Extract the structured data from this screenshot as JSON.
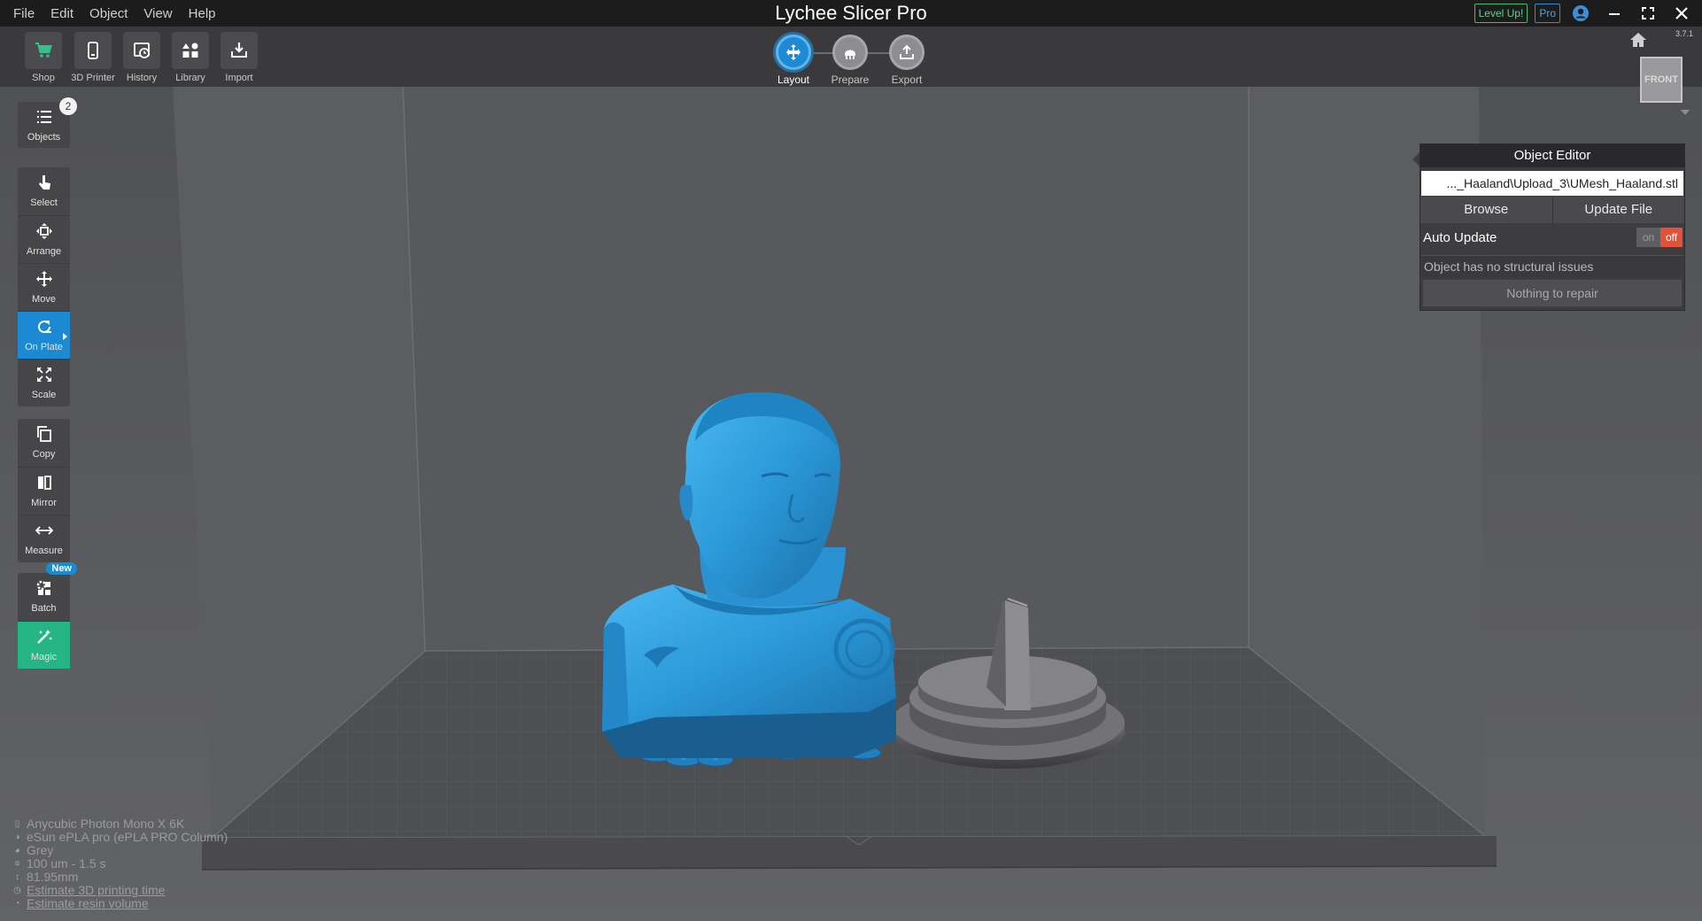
{
  "menu": [
    "File",
    "Edit",
    "Object",
    "View",
    "Help"
  ],
  "app": {
    "title": "Lychee Slicer Pro",
    "version": "3.7.1"
  },
  "title_right": {
    "level_up": "Level Up!",
    "pro": "Pro"
  },
  "toolbar": {
    "items": [
      {
        "label": "Shop",
        "icon": "cart-icon"
      },
      {
        "label": "3D Printer",
        "icon": "printer-icon"
      },
      {
        "label": "History",
        "icon": "history-icon"
      },
      {
        "label": "Library",
        "icon": "library-icon"
      },
      {
        "label": "Import",
        "icon": "import-icon"
      }
    ]
  },
  "workflow": {
    "steps": [
      {
        "label": "Layout",
        "active": true
      },
      {
        "label": "Prepare",
        "active": false
      },
      {
        "label": "Export",
        "active": false
      }
    ]
  },
  "viewcube": {
    "face": "FRONT"
  },
  "tools": {
    "objects": {
      "label": "Objects",
      "count": "2"
    },
    "select": "Select",
    "arrange": "Arrange",
    "move": "Move",
    "on_plate": "On Plate",
    "scale": "Scale",
    "copy": "Copy",
    "mirror": "Mirror",
    "measure": "Measure",
    "batch": "Batch",
    "batch_badge": "New",
    "magic": "Magic"
  },
  "object_editor": {
    "title": "Object Editor",
    "path": "..._Haaland\\Upload_3\\UMesh_Haaland.stl",
    "browse": "Browse",
    "update_file": "Update File",
    "auto_update_label": "Auto Update",
    "toggle_on": "on",
    "toggle_off": "off",
    "auto_update_value": "off",
    "status": "Object has no structural issues",
    "repair": "Nothing to repair"
  },
  "info": {
    "printer": "Anycubic Photon Mono X 6K",
    "resin": "eSun ePLA pro (ePLA PRO Column)",
    "color": "Grey",
    "layer": "100 um - 1.5 s",
    "height": "81.95mm",
    "estimate_time": "Estimate 3D printing time",
    "estimate_volume": "Estimate resin volume"
  },
  "colors": {
    "accent": "#1c8ad3",
    "magic": "#25b585",
    "model": "#2e9bd8",
    "toggle_off": "#e0533a",
    "background": "#5a5b5e"
  }
}
